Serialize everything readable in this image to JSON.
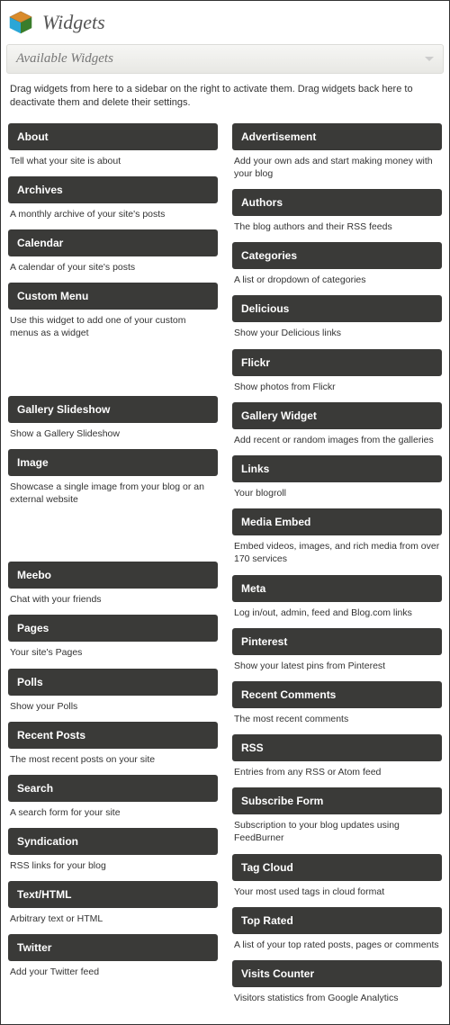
{
  "header": {
    "title": "Widgets"
  },
  "panel": {
    "title": "Available Widgets",
    "intro": "Drag widgets from here to a sidebar on the right to activate them. Drag widgets back here to deactivate them and delete their settings."
  },
  "left": [
    {
      "title": "About",
      "desc": "Tell what your site is about"
    },
    {
      "title": "Archives",
      "desc": "A monthly archive of your site's posts"
    },
    {
      "title": "Calendar",
      "desc": "A calendar of your site's posts"
    },
    {
      "title": "Custom Menu",
      "desc": "Use this widget to add one of your custom menus as a widget"
    },
    {
      "title": "Gallery Slideshow",
      "desc": "Show a Gallery Slideshow"
    },
    {
      "title": "Image",
      "desc": "Showcase a single image from your blog or an external website"
    },
    {
      "title": "Meebo",
      "desc": "Chat with your friends"
    },
    {
      "title": "Pages",
      "desc": "Your site's Pages"
    },
    {
      "title": "Polls",
      "desc": "Show your Polls"
    },
    {
      "title": "Recent Posts",
      "desc": "The most recent posts on your site"
    },
    {
      "title": "Search",
      "desc": "A search form for your site"
    },
    {
      "title": "Syndication",
      "desc": "RSS links for your blog"
    },
    {
      "title": "Text/HTML",
      "desc": "Arbitrary text or HTML"
    },
    {
      "title": "Twitter",
      "desc": "Add your Twitter feed"
    }
  ],
  "right": [
    {
      "title": "Advertisement",
      "desc": "Add your own ads and start making money with your blog"
    },
    {
      "title": "Authors",
      "desc": "The blog authors and their RSS feeds"
    },
    {
      "title": "Categories",
      "desc": "A list or dropdown of categories"
    },
    {
      "title": "Delicious",
      "desc": "Show your Delicious links"
    },
    {
      "title": "Flickr",
      "desc": "Show photos from Flickr"
    },
    {
      "title": "Gallery Widget",
      "desc": "Add recent or random images from the galleries"
    },
    {
      "title": "Links",
      "desc": "Your blogroll"
    },
    {
      "title": "Media Embed",
      "desc": "Embed videos, images, and rich media from over 170 services"
    },
    {
      "title": "Meta",
      "desc": "Log in/out, admin, feed and Blog.com links"
    },
    {
      "title": "Pinterest",
      "desc": "Show your latest pins from Pinterest"
    },
    {
      "title": "Recent Comments",
      "desc": "The most recent comments"
    },
    {
      "title": "RSS",
      "desc": "Entries from any RSS or Atom feed"
    },
    {
      "title": "Subscribe Form",
      "desc": "Subscription to your blog updates using FeedBurner"
    },
    {
      "title": "Tag Cloud",
      "desc": "Your most used tags in cloud format"
    },
    {
      "title": "Top Rated",
      "desc": "A list of your top rated posts, pages or comments"
    },
    {
      "title": "Visits Counter",
      "desc": "Visitors statistics from Google Analytics"
    }
  ],
  "left_gaps": {
    "after_3": 52,
    "after_5": 52
  }
}
